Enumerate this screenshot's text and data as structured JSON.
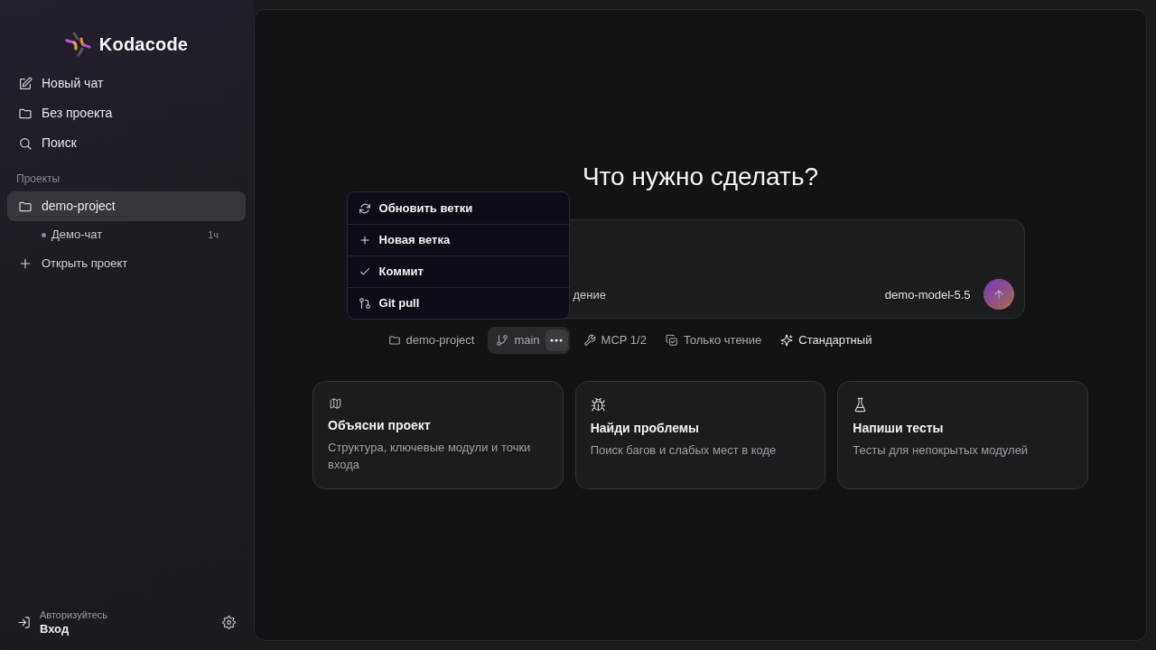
{
  "sidebar": {
    "logo": {
      "text": "Kodacode"
    },
    "nav": [
      {
        "kind": "new-chat",
        "label": "Новый чат"
      },
      {
        "kind": "folder",
        "label": "Без проекта"
      },
      {
        "kind": "search",
        "label": "Поиск"
      }
    ],
    "section_title": "Проекты",
    "projects": [
      {
        "label": "demo-project",
        "selected": true,
        "children": [
          {
            "label": "Демо-чат",
            "time": "1ч"
          }
        ]
      }
    ],
    "open_project": "Открыть проект",
    "account": {
      "hint": "Авторизуйтесь",
      "action": "Вход"
    }
  },
  "main": {
    "heading": "Что нужно сделать?",
    "composer": {
      "mode_text": "дение",
      "model": "demo-model-5.5"
    },
    "toolbar": [
      {
        "kind": "folder",
        "label": "demo-project",
        "active": false
      },
      {
        "kind": "branch",
        "label": "main",
        "active": true
      },
      {
        "kind": "mcp",
        "label": "MCP 1/2",
        "active": false
      },
      {
        "kind": "permissions",
        "label": "Только чтение",
        "active": false
      },
      {
        "kind": "mode",
        "label": "Стандартный",
        "active": false
      }
    ],
    "branch_menu": {
      "items": [
        {
          "kind": "refresh",
          "label": "Обновить ветки"
        },
        {
          "kind": "new",
          "label": "Новая ветка"
        },
        {
          "kind": "commit",
          "label": "Коммит"
        },
        {
          "kind": "pull",
          "label": "Git pull"
        }
      ]
    },
    "cards": [
      {
        "kind": "map",
        "title": "Объясни проект",
        "description": "Структура, ключевые модули и точки входа"
      },
      {
        "kind": "bug",
        "title": "Найди проблемы",
        "description": "Поиск багов и слабых мест в коде"
      },
      {
        "kind": "flask",
        "title": "Напиши тесты",
        "description": "Тесты для непокрытых модулей"
      }
    ]
  }
}
